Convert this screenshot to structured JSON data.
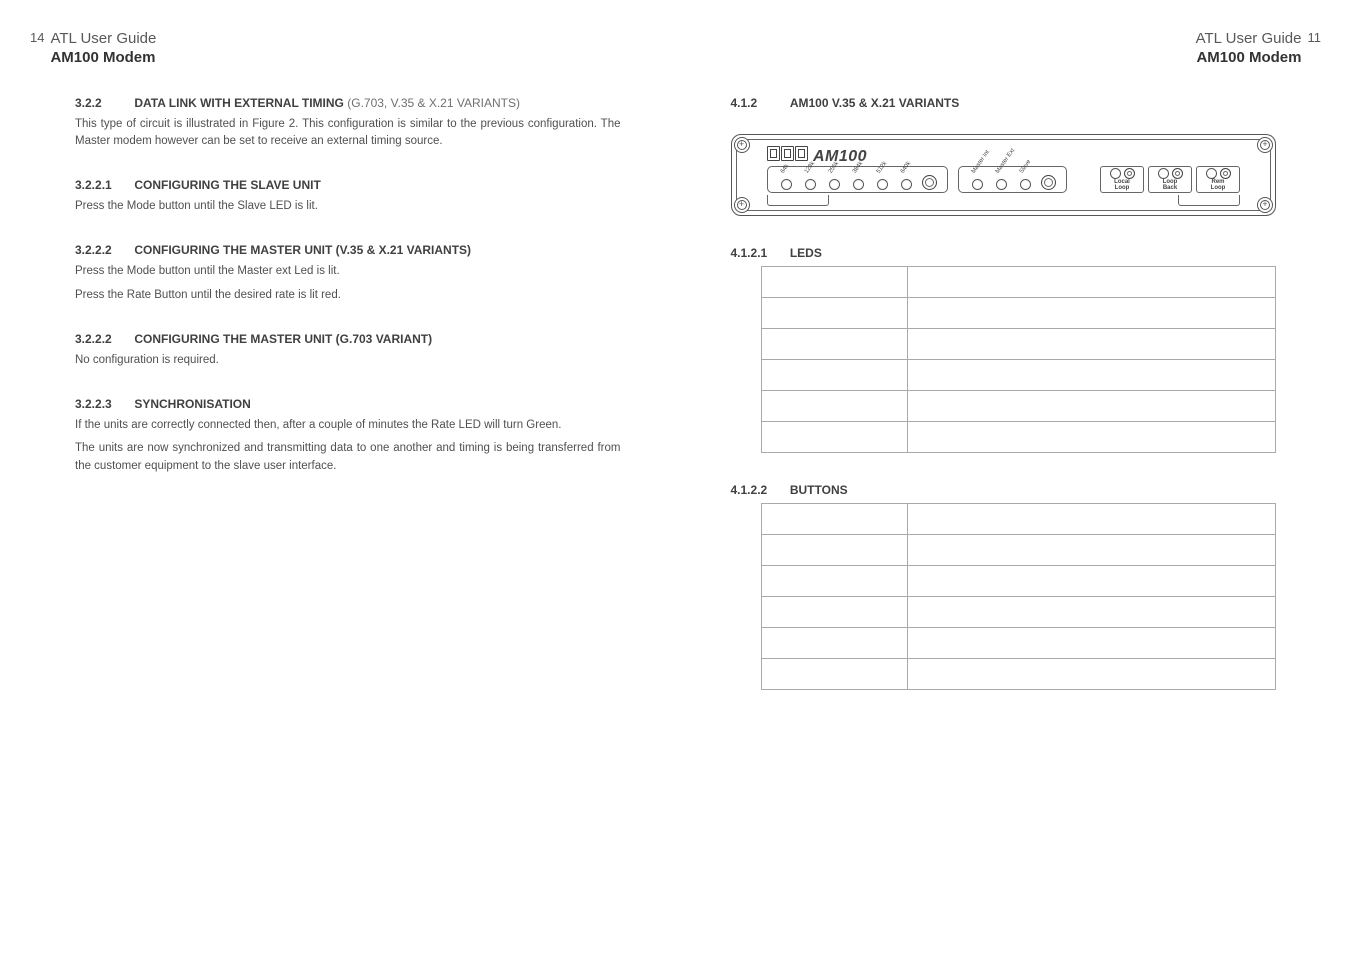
{
  "doc": {
    "title_line1": "ATL User Guide",
    "title_line2": "AM100 Modem"
  },
  "left_page": {
    "number": "14",
    "s1": {
      "num": "3.2.2",
      "title": "DATA LINK WITH EXTERNAL TIMING",
      "suffix": "(G.703, V.35 & X.21 VARIANTS)"
    },
    "p1": "This type of circuit is illustrated in Figure 2. This configuration is similar to the previous configuration. The Master modem however can be set to receive an external timing source.",
    "s2": {
      "num": "3.2.2.1",
      "title": "CONFIGURING THE SLAVE UNIT"
    },
    "p2": "Press the Mode button until the Slave LED is lit.",
    "s3": {
      "num": "3.2.2.2",
      "title": "CONFIGURING THE MASTER UNIT (V.35 & X.21 VARIANTS)"
    },
    "p3a": "Press the Mode button until the Master ext Led is lit.",
    "p3b": "Press the Rate Button until the desired rate is lit red.",
    "s4": {
      "num": "3.2.2.2",
      "title": "CONFIGURING THE MASTER UNIT (G.703 VARIANT)"
    },
    "p4": "No configuration is required.",
    "s5": {
      "num": "3.2.2.3",
      "title": "SYNCHRONISATION"
    },
    "p5a": "If the units are correctly connected then, after a couple of minutes the Rate LED will turn Green.",
    "p5b": "The units are now synchronized and transmitting data to one another and timing is being transferred from the customer equipment to the slave user interface."
  },
  "right_page": {
    "number": "11",
    "s1": {
      "num": "4.1.2",
      "title": "AM100 V.35 & X.21 VARIANTS"
    },
    "panel": {
      "brand_model": "AM100",
      "rate_labels": [
        "64k",
        "128k",
        "256k",
        "384k",
        "512k",
        "640k"
      ],
      "mode_labels": [
        "Master Int",
        "Master Ext",
        "Slave"
      ],
      "test_groups": [
        {
          "label": "Local\nLoop"
        },
        {
          "label": "Loop\nBack"
        },
        {
          "label": "Rem\nLoop"
        }
      ]
    },
    "s2": {
      "num": "4.1.2.1",
      "title": "LEDS"
    },
    "leds_table_rows": 6,
    "s3": {
      "num": "4.1.2.2",
      "title": "BUTTONS"
    },
    "buttons_table_rows": 6
  }
}
